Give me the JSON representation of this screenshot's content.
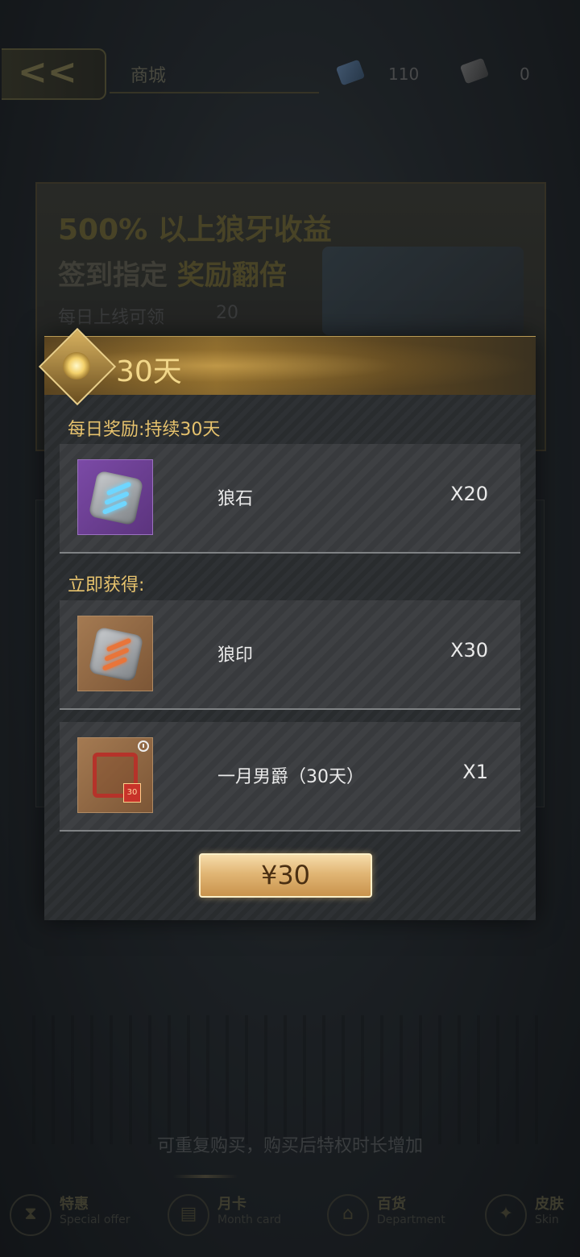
{
  "background": {
    "page_title": "商城",
    "resources": [
      {
        "icon": "wolf-stone-resource-icon",
        "value": "110"
      },
      {
        "icon": "wolf-seal-resource-icon",
        "value": "0"
      }
    ],
    "banner": {
      "line1": "500% 以上狼牙收益",
      "line2_plain": "签到指定",
      "line2_bold": "奖励翻倍",
      "sub": "每日上线可领",
      "sub_value": "20"
    },
    "footer_note": "可重复购买，购买后特权时长增加",
    "nav": [
      {
        "label": "特惠",
        "sub": "Special offer",
        "icon": "hourglass-icon"
      },
      {
        "label": "月卡",
        "sub": "Month card",
        "icon": "card-icon"
      },
      {
        "label": "百货",
        "sub": "Department",
        "icon": "store-icon"
      },
      {
        "label": "皮肤",
        "sub": "Skin",
        "icon": "skin-icon"
      }
    ]
  },
  "modal": {
    "title": "30天",
    "daily_label": "每日奖励:持续30天",
    "instant_label": "立即获得:",
    "daily_items": [
      {
        "name": "狼石",
        "qty": "X20",
        "icon": "wolf-stone-icon",
        "rarity_color": "#7b4aa6"
      }
    ],
    "instant_items": [
      {
        "name": "狼印",
        "qty": "X30",
        "icon": "wolf-seal-icon",
        "rarity_color": "#a47a52"
      },
      {
        "name": "一月男爵（30天）",
        "qty": "X1",
        "icon": "avatar-frame-icon",
        "badge": "30",
        "rarity_color": "#a47a52"
      }
    ],
    "buy_label": "¥30"
  },
  "colors": {
    "accent_gold": "#e6c26d",
    "button_gold": "#e1b675",
    "panel_bg": "#2a2d30"
  }
}
